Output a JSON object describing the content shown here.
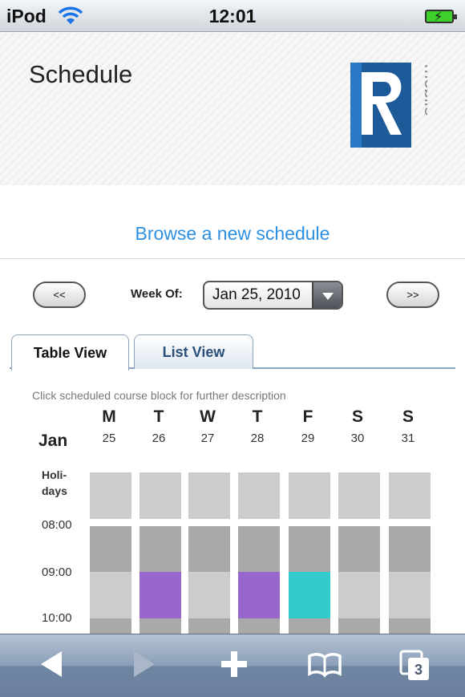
{
  "status_bar": {
    "carrier": "iPod",
    "time": "12:01"
  },
  "header": {
    "title": "Schedule",
    "logo_text": "mobile"
  },
  "browse_link": "Browse a new schedule",
  "week_nav": {
    "prev_label": "<<",
    "next_label": ">>",
    "week_label": "Week Of:",
    "week_value": "Jan 25, 2010"
  },
  "tabs": [
    {
      "label": "Table View",
      "active": true
    },
    {
      "label": "List View",
      "active": false
    }
  ],
  "calendar": {
    "hint": "Click scheduled course block for further description",
    "month": "Jan",
    "days": [
      {
        "letter": "M",
        "num": "25"
      },
      {
        "letter": "T",
        "num": "26"
      },
      {
        "letter": "W",
        "num": "27"
      },
      {
        "letter": "T",
        "num": "28"
      },
      {
        "letter": "F",
        "num": "29"
      },
      {
        "letter": "S",
        "num": "30"
      },
      {
        "letter": "S",
        "num": "31"
      }
    ],
    "holidays_label": [
      "Holi-",
      "days"
    ],
    "time_labels": [
      "08:00",
      "09:00",
      "10:00"
    ],
    "colors": {
      "empty_light": "#cccccc",
      "empty_dark": "#a9a9a9",
      "course_purple": "#9966cc",
      "course_teal": "#33cccc"
    },
    "course_blocks": [
      {
        "day": "T",
        "date": "26",
        "start": "09:00",
        "color": "purple"
      },
      {
        "day": "T",
        "date": "28",
        "start": "09:00",
        "color": "purple"
      },
      {
        "day": "F",
        "date": "29",
        "start": "09:00",
        "color": "teal"
      }
    ]
  },
  "toolbar": {
    "icons": [
      "back-icon",
      "forward-icon",
      "add-icon",
      "bookmarks-icon",
      "pages-icon"
    ],
    "pages_count": "3"
  }
}
